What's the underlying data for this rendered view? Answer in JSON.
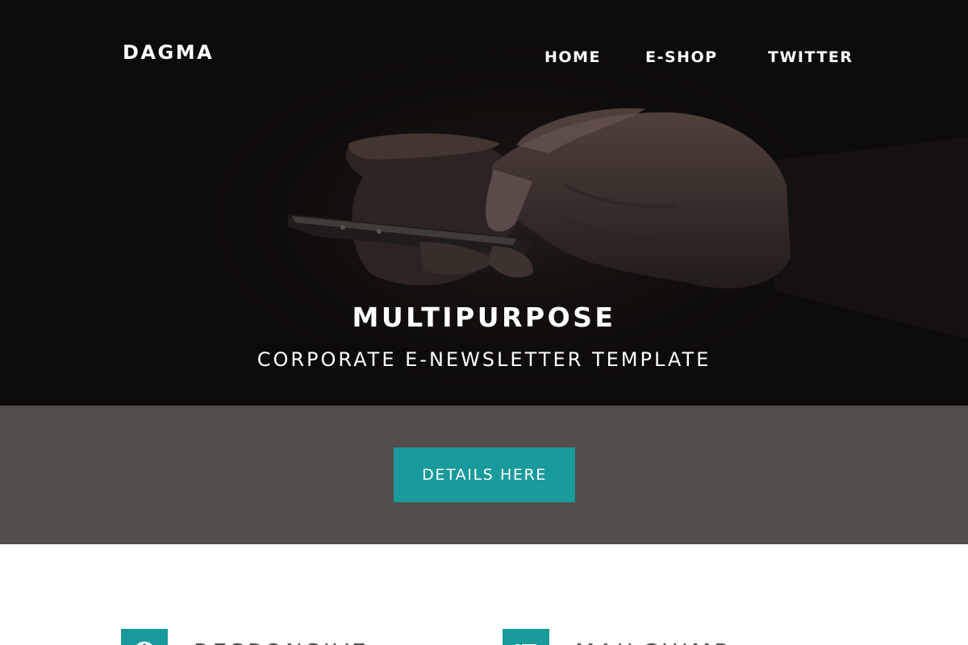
{
  "header": {
    "logo": "DAGMA",
    "nav": [
      {
        "label": "HOME"
      },
      {
        "label": "E-SHOP"
      },
      {
        "label": "TWITTER"
      }
    ]
  },
  "hero": {
    "title": "MULTIPURPOSE",
    "subtitle": "CORPORATE E-NEWSLETTER TEMPLATE",
    "image": "hands-holding-smartphone-photo"
  },
  "cta": {
    "label": "DETAILS HERE"
  },
  "features": [
    {
      "label": "RESPONSIVE",
      "icon": "globe-icon"
    },
    {
      "label": "MAILCHIMP",
      "icon": "list-icon"
    }
  ],
  "colors": {
    "hero_background": "#120f0e",
    "cta_band": "#524d4a",
    "accent": "#199a9c",
    "feature_text": "#555555"
  }
}
